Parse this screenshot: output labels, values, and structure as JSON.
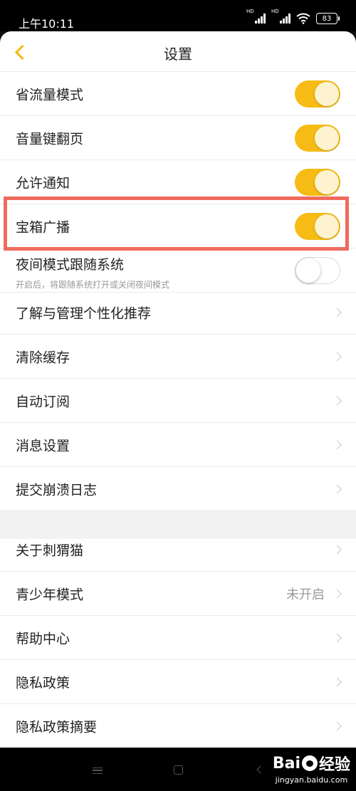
{
  "status": {
    "time": "上午10:11",
    "hd1": "HD",
    "hd2": "HD",
    "battery": "83"
  },
  "header": {
    "title": "设置"
  },
  "toggles": [
    {
      "label": "省流量模式",
      "on": true
    },
    {
      "label": "音量键翻页",
      "on": true
    },
    {
      "label": "允许通知",
      "on": true
    },
    {
      "label": "宝箱广播",
      "on": true
    },
    {
      "label": "夜间模式跟随系统",
      "sub": "开启后，将跟随系统打开或关闭夜间模式",
      "on": false
    }
  ],
  "group1": [
    {
      "label": "了解与管理个性化推荐"
    },
    {
      "label": "清除缓存"
    },
    {
      "label": "自动订阅"
    },
    {
      "label": "消息设置"
    },
    {
      "label": "提交崩溃日志"
    }
  ],
  "group2": [
    {
      "label": "关于刺猬猫"
    },
    {
      "label": "青少年模式",
      "value": "未开启"
    },
    {
      "label": "帮助中心"
    },
    {
      "label": "隐私政策"
    },
    {
      "label": "隐私政策摘要"
    }
  ],
  "watermark": {
    "brand_left": "Bai",
    "brand_right": "经验",
    "url": "jingyan.baidu.com"
  },
  "colors": {
    "accent": "#f6bb14",
    "highlight": "#ef6b5e"
  },
  "icons": [
    "back-arrow-icon",
    "wifi-icon",
    "signal-icon",
    "chevron-right-icon",
    "menu-icon",
    "home-icon",
    "nav-back-icon"
  ]
}
